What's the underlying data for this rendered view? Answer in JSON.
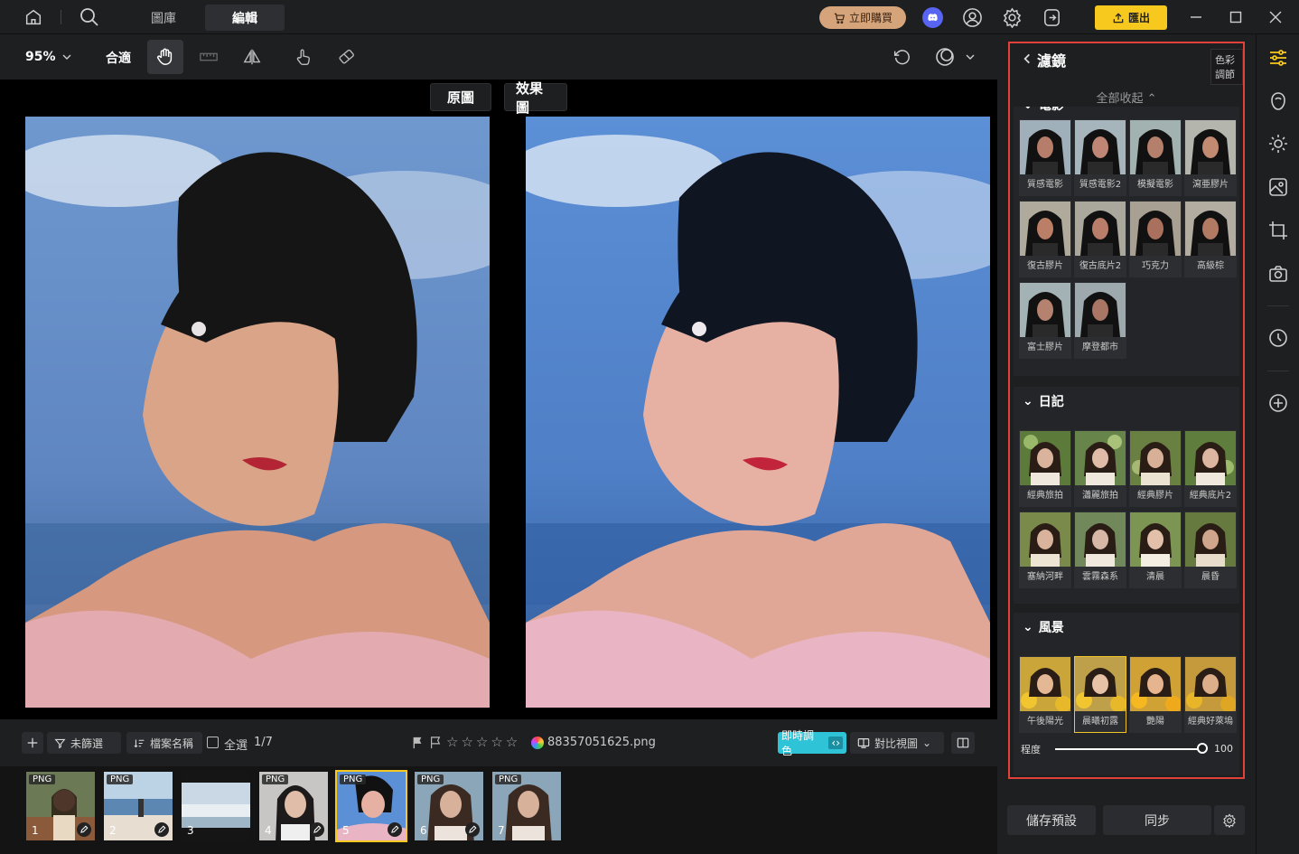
{
  "tabs": [
    {
      "label": "圖庫"
    },
    {
      "label": "編輯"
    }
  ],
  "buy_label": "立即購買",
  "export_label": "匯出",
  "toolbar": {
    "zoom": "95%",
    "fit": "合適"
  },
  "compare": {
    "original": "原圖",
    "effect": "效果圖"
  },
  "bottom": {
    "filter": "未篩選",
    "sort": "檔案名稱",
    "select_all": "全選",
    "count": "1/7",
    "filename": "88357051625.png",
    "live": "即時調色",
    "compare_view": "對比視圖"
  },
  "thumbs": [
    {
      "tag": "PNG",
      "num": "1"
    },
    {
      "tag": "PNG",
      "num": "2"
    },
    {
      "tag": "",
      "num": "3"
    },
    {
      "tag": "PNG",
      "num": "4"
    },
    {
      "tag": "PNG",
      "num": "5"
    },
    {
      "tag": "PNG",
      "num": "6"
    },
    {
      "tag": "PNG",
      "num": "7"
    }
  ],
  "panel": {
    "title": "濾鏡",
    "tab_tag": "色彩調節",
    "collapse_all": "全部收起",
    "sections": [
      {
        "name": "電影",
        "items": [
          "質感電影",
          "質感電影2",
          "模擬電影",
          "瀉亜膠片",
          "復古膠片",
          "復古底片2",
          "巧克力",
          "高級棕",
          "富士膠片",
          "摩登都市"
        ]
      },
      {
        "name": "日記",
        "items": [
          "經典旅拍",
          "瀟麗旅拍",
          "經典膠片",
          "經典底片2",
          "塞納河畔",
          "雲霧森系",
          "清晨",
          "晨昏"
        ]
      },
      {
        "name": "風景",
        "items": [
          "午後陽光",
          "晨曦初露",
          "艷陽",
          "經典好萊塢"
        ]
      }
    ],
    "degree_label": "程度",
    "degree_value": "100",
    "save_preset": "儲存預設",
    "sync": "同步"
  },
  "colors": {
    "accent": "#f7c81d",
    "highlight_border": "#e2413a",
    "buy": "#d6a47a",
    "live": "#2ec3d6"
  }
}
